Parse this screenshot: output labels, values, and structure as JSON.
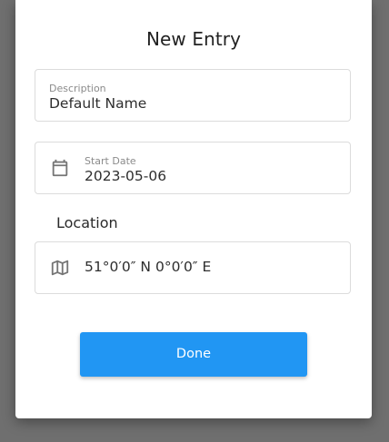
{
  "dialog": {
    "title": "New Entry"
  },
  "description_field": {
    "label": "Description",
    "value": "Default Name"
  },
  "start_date_field": {
    "label": "Start Date",
    "value": "2023-05-06",
    "icon": "calendar-icon"
  },
  "location_section": {
    "heading": "Location",
    "value": "51°0′0″ N 0°0′0″ E",
    "icon": "map-icon"
  },
  "done_button": {
    "label": "Done"
  },
  "colors": {
    "accent": "#2196f3",
    "backdrop": "#6f6f6f"
  }
}
